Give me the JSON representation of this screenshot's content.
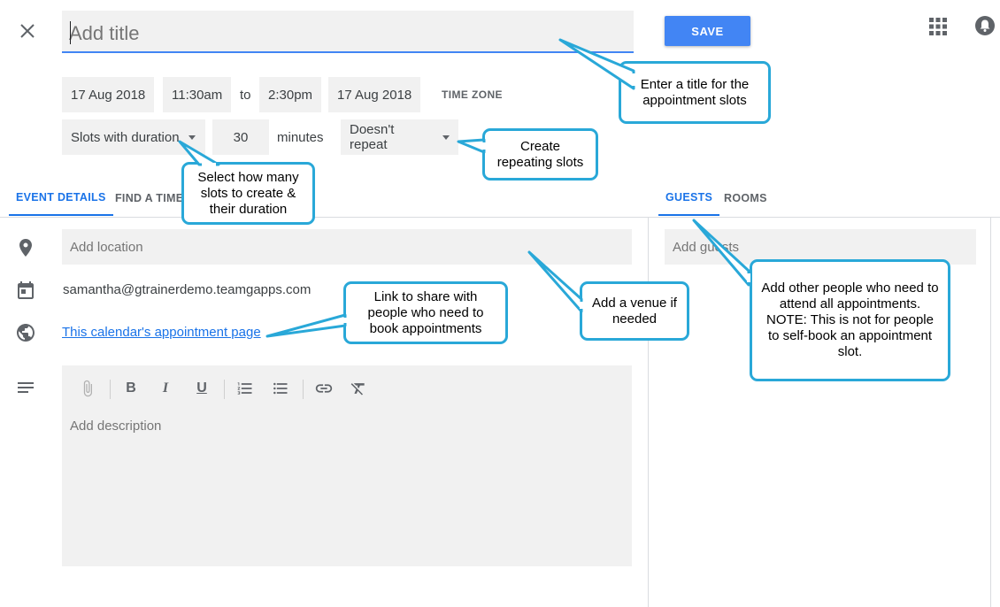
{
  "header": {
    "close_label": "Close",
    "title_placeholder": "Add title",
    "title_value": "",
    "save_label": "SAVE",
    "apps_icon": "apps-grid-icon",
    "notifications_icon": "notifications-icon"
  },
  "schedule": {
    "start_date": "17 Aug 2018",
    "start_time": "11:30am",
    "to_label": "to",
    "end_time": "2:30pm",
    "end_date": "17 Aug 2018",
    "time_zone_label": "TIME ZONE"
  },
  "slots": {
    "mode_selected": "Slots with duration",
    "duration_value": "30",
    "duration_unit": "minutes",
    "repeat_selected": "Doesn't repeat"
  },
  "tabs": {
    "left": [
      {
        "label": "EVENT DETAILS",
        "active": true
      },
      {
        "label": "FIND A TIME",
        "active": false
      }
    ],
    "right": [
      {
        "label": "GUESTS",
        "active": true
      },
      {
        "label": "ROOMS",
        "active": false
      }
    ]
  },
  "details": {
    "location_placeholder": "Add location",
    "calendar_owner": "samantha@gtrainerdemo.teamgapps.com",
    "appointment_page_link": "This calendar's appointment page",
    "description_placeholder": "Add description",
    "toolbar": [
      "attachment-icon",
      "bold-icon",
      "italic-icon",
      "underline-icon",
      "numbered-list-icon",
      "bulleted-list-icon",
      "link-icon",
      "remove-formatting-icon"
    ]
  },
  "guests": {
    "add_guests_placeholder": "Add guests"
  },
  "callouts": {
    "title": "Enter a title for the appointment slots",
    "repeat": "Create repeating slots",
    "slots": "Select how many slots to create & their duration",
    "venue": "Add a venue if needed",
    "link": "Link to share with people who need to book appointments",
    "guests": "Add other people who need to attend all appointments. NOTE: This is not for people to self-book an appointment slot."
  },
  "colors": {
    "accent": "#4285f4",
    "tab_active": "#1a73e8",
    "callout_border": "#29a8d8",
    "field_bg": "#f1f1f1"
  }
}
